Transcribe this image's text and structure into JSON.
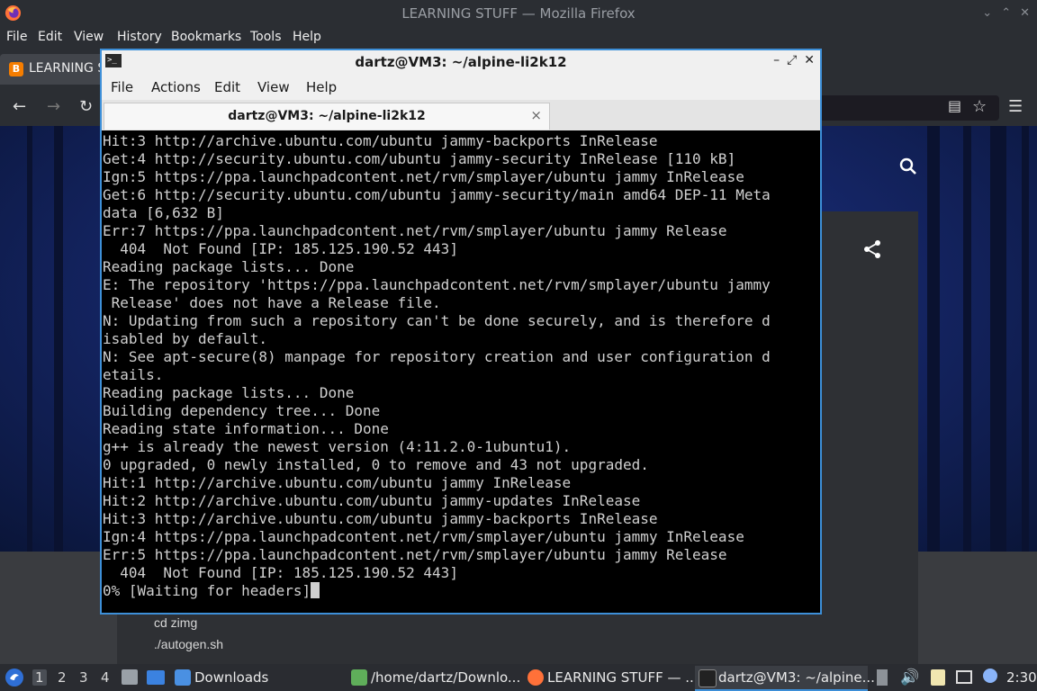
{
  "firefox": {
    "window_title": "LEARNING STUFF — Mozilla Firefox",
    "menu": [
      "File",
      "Edit",
      "View",
      "History",
      "Bookmarks",
      "Tools",
      "Help"
    ],
    "tab_label": "LEARNING S",
    "tab_favicon": "B"
  },
  "page": {
    "code_lines": [
      "cd zimg",
      "./autogen.sh"
    ]
  },
  "terminal": {
    "title": "dartz@VM3: ~/alpine-li2k12",
    "title_icon": ">_",
    "menu": [
      "File",
      "Actions",
      "Edit",
      "View",
      "Help"
    ],
    "tab_label": "dartz@VM3: ~/alpine-li2k12",
    "tab_close": "×",
    "lines": [
      "Hit:3 http://archive.ubuntu.com/ubuntu jammy-backports InRelease",
      "Get:4 http://security.ubuntu.com/ubuntu jammy-security InRelease [110 kB]",
      "Ign:5 https://ppa.launchpadcontent.net/rvm/smplayer/ubuntu jammy InRelease",
      "Get:6 http://security.ubuntu.com/ubuntu jammy-security/main amd64 DEP-11 Meta",
      "data [6,632 B]",
      "Err:7 https://ppa.launchpadcontent.net/rvm/smplayer/ubuntu jammy Release",
      "  404  Not Found [IP: 185.125.190.52 443]",
      "Reading package lists... Done",
      "E: The repository 'https://ppa.launchpadcontent.net/rvm/smplayer/ubuntu jammy",
      " Release' does not have a Release file.",
      "N: Updating from such a repository can't be done securely, and is therefore d",
      "isabled by default.",
      "N: See apt-secure(8) manpage for repository creation and user configuration d",
      "etails.",
      "Reading package lists... Done",
      "Building dependency tree... Done",
      "Reading state information... Done",
      "g++ is already the newest version (4:11.2.0-1ubuntu1).",
      "0 upgraded, 0 newly installed, 0 to remove and 43 not upgraded.",
      "Hit:1 http://archive.ubuntu.com/ubuntu jammy InRelease",
      "Hit:2 http://archive.ubuntu.com/ubuntu jammy-updates InRelease",
      "Hit:3 http://archive.ubuntu.com/ubuntu jammy-backports InRelease",
      "Ign:4 https://ppa.launchpadcontent.net/rvm/smplayer/ubuntu jammy InRelease",
      "Err:5 https://ppa.launchpadcontent.net/rvm/smplayer/ubuntu jammy Release",
      "  404  Not Found [IP: 185.125.190.52 443]"
    ],
    "prompt_line": "0% [Waiting for headers]"
  },
  "taskbar": {
    "workspaces": [
      "1",
      "2",
      "3",
      "4"
    ],
    "active_workspace": "1",
    "tasks": [
      {
        "label": "Downloads",
        "icon": "folder-icon"
      },
      {
        "label": "/home/dartz/Downlo...",
        "icon": "image-viewer-icon"
      },
      {
        "label": "LEARNING STUFF — ...",
        "icon": "firefox-icon"
      },
      {
        "label": "dartz@VM3: ~/alpine...",
        "icon": "terminal-icon"
      }
    ],
    "clock": "2:30"
  },
  "colors": {
    "terminal_border": "#3d8fd8",
    "terminal_bg": "#000000",
    "terminal_text": "#d0d0d0",
    "firefox_chrome": "#2b2e33",
    "taskbar_bg": "#2a2c31"
  }
}
